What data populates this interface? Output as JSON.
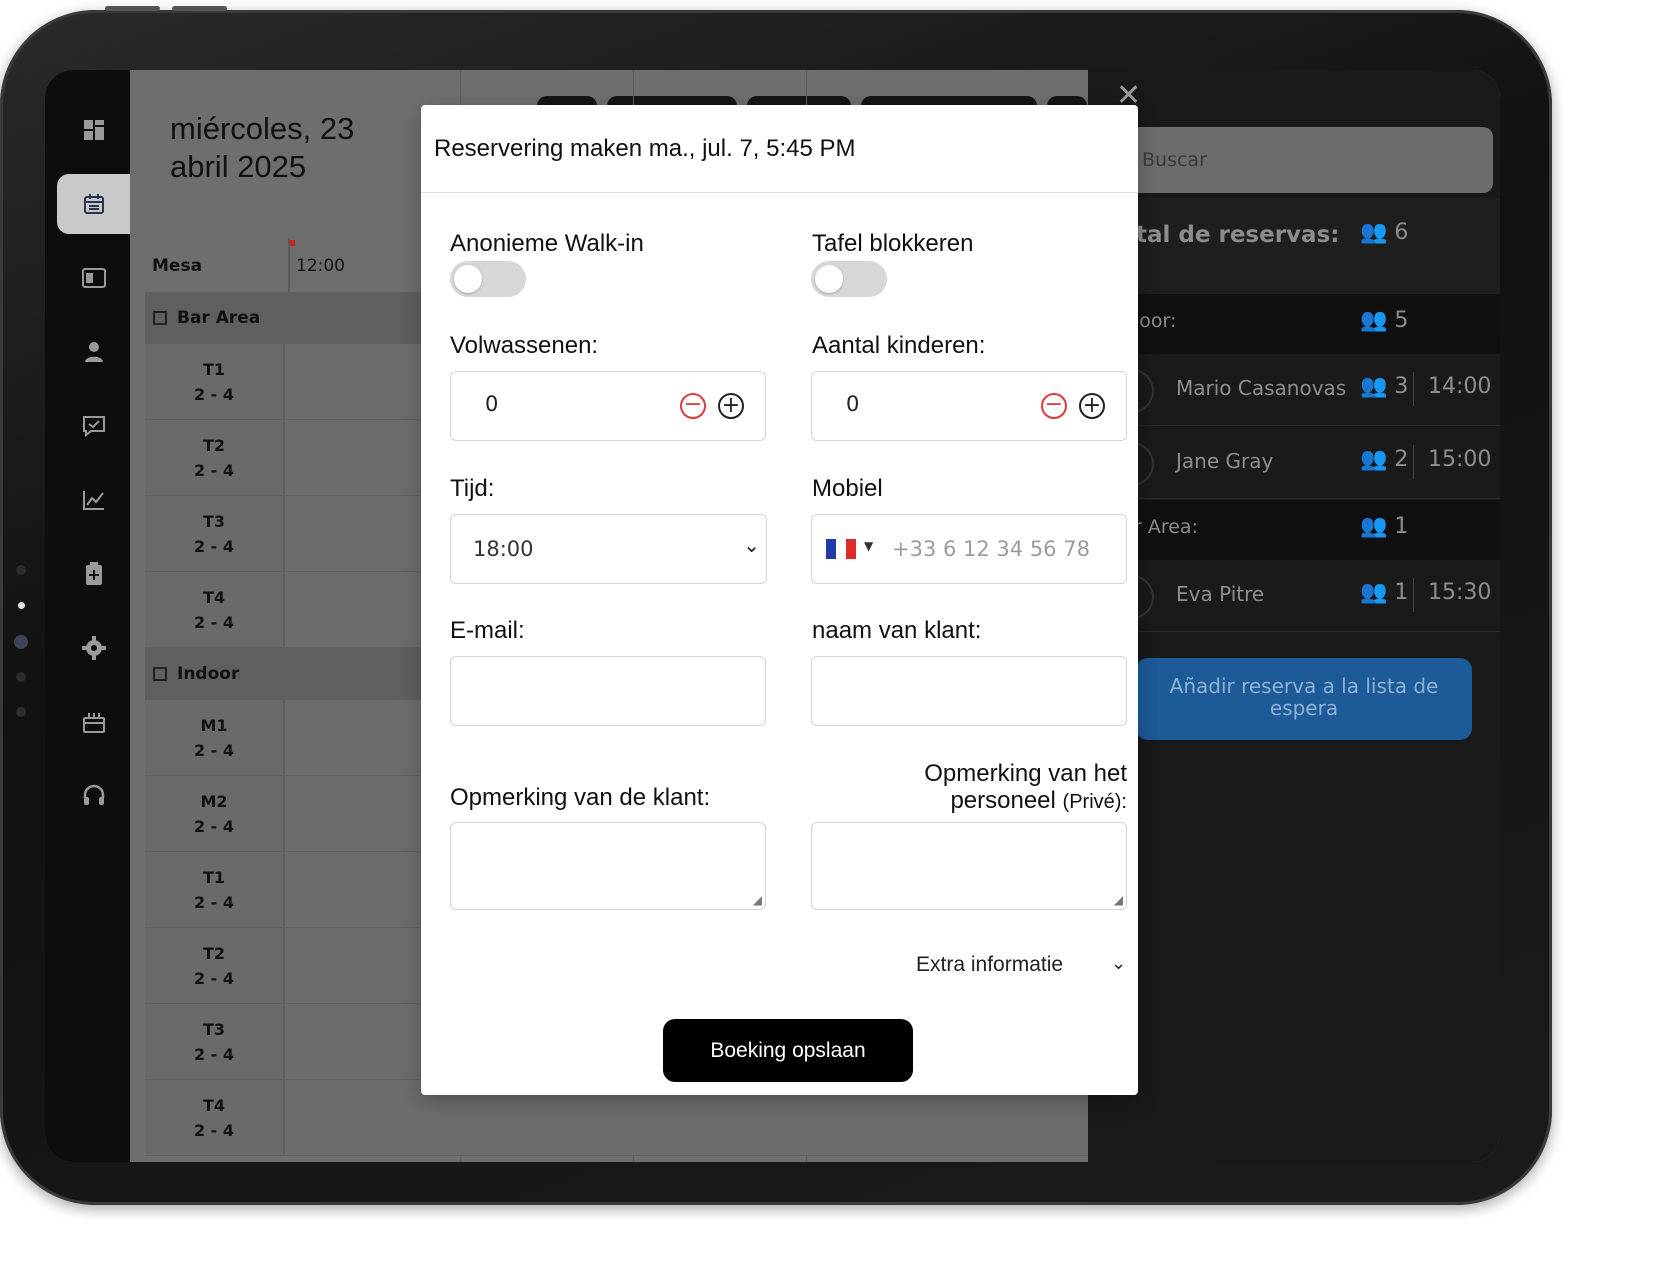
{
  "sidebar": {
    "items": [
      {
        "icon": "dashboard-icon"
      },
      {
        "icon": "calendar-icon"
      },
      {
        "icon": "floorplan-icon"
      },
      {
        "icon": "user-icon"
      },
      {
        "icon": "chat-check-icon"
      },
      {
        "icon": "chart-icon"
      },
      {
        "icon": "clipboard-plus-icon"
      },
      {
        "icon": "gear-icon"
      },
      {
        "icon": "gift-icon"
      },
      {
        "icon": "headset-icon"
      }
    ]
  },
  "calendar": {
    "date_line1": "miércoles, 23",
    "date_line2": "abril 2025",
    "col_mesa": "Mesa",
    "col_time": "12:00",
    "areas": [
      {
        "name": "Bar Area",
        "tables": [
          {
            "name": "T1",
            "capacity": "2 - 4"
          },
          {
            "name": "T2",
            "capacity": "2 - 4"
          },
          {
            "name": "T3",
            "capacity": "2 - 4"
          },
          {
            "name": "T4",
            "capacity": "2 - 4"
          }
        ]
      },
      {
        "name": "Indoor",
        "tables": [
          {
            "name": "M1",
            "capacity": "2 - 4"
          },
          {
            "name": "M2",
            "capacity": "2 - 4"
          },
          {
            "name": "T1",
            "capacity": "2 - 4"
          },
          {
            "name": "T2",
            "capacity": "2 - 4"
          },
          {
            "name": "T3",
            "capacity": "2 - 4"
          },
          {
            "name": "T4",
            "capacity": "2 - 4"
          }
        ]
      }
    ]
  },
  "right_panel": {
    "search_placeholder": "Buscar",
    "total_label": "tal de reservas:",
    "total_count": "6",
    "sections": [
      {
        "label": "loor:",
        "count": "5"
      },
      {
        "label": "r Area:",
        "count": "1"
      }
    ],
    "reservations": [
      {
        "name": "Mario Casanovas",
        "guests": "3",
        "time": "14:00"
      },
      {
        "name": "Jane Gray",
        "guests": "2",
        "time": "15:00"
      },
      {
        "name": "Eva Pitre",
        "guests": "1",
        "time": "15:30"
      }
    ],
    "waitlist_button": "Añadir reserva a la lista de espera"
  },
  "modal": {
    "title": "Reservering maken ma., jul. 7, 5:45 PM",
    "walkin_label": "Anonieme Walk-in",
    "walkin_on": false,
    "block_label": "Tafel blokkeren",
    "block_on": false,
    "adults_label": "Volwassenen:",
    "adults_value": "0",
    "children_label": "Aantal kinderen:",
    "children_value": "0",
    "time_label": "Tijd:",
    "time_value": "18:00",
    "mobile_label": "Mobiel",
    "mobile_placeholder": "+33 6 12 34 56 78",
    "email_label": "E-mail:",
    "name_label": "naam van klant:",
    "client_note_label": "Opmerking van de klant:",
    "staff_note_label_line1": "Opmerking van het",
    "staff_note_label_line2": "personeel",
    "staff_note_private": "(Privé):",
    "extra_info": "Extra informatie",
    "save_button": "Boeking opslaan"
  }
}
